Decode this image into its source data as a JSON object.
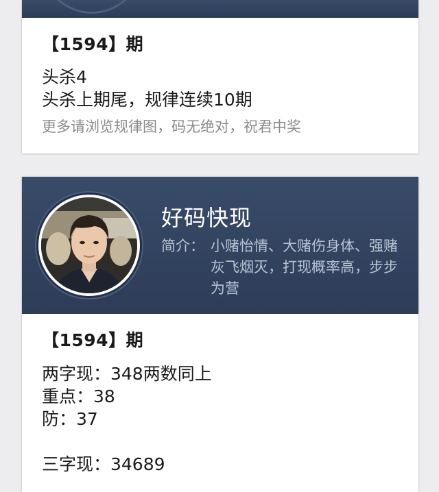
{
  "card_top": {
    "issue_label": "【1594】期",
    "lines": [
      "头杀4",
      "头杀上期尾，规律连续10期"
    ],
    "note": "更多请浏览规律图，码无绝对，祝君中奖"
  },
  "card_profile": {
    "name": "好码快现",
    "intro_label": "简介：",
    "intro_text": "小赌怡情、大赌伤身体、强赌灰飞烟灭，打现概率高，步步为营",
    "issue_label": "【1594】期",
    "lines": [
      "两字现：348两数同上",
      "重点：38",
      "防：37",
      "",
      "三字现：34689"
    ]
  },
  "colors": {
    "header_bg": "#33445f",
    "page_bg": "#ededf0",
    "intro_text": "#b9c3d2",
    "note_text": "#8a8a8a"
  }
}
